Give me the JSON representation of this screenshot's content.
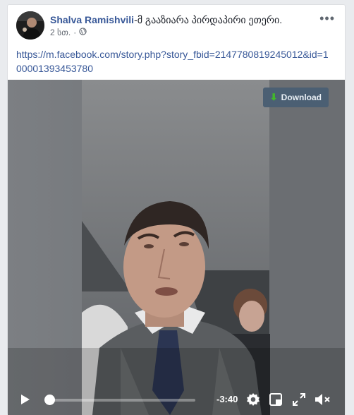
{
  "post": {
    "author": "Shalva Ramishvili",
    "title_suffix": "-მ გააზიარა პირდაპირი ეთერი.",
    "time": "2 სთ.",
    "separator": "·",
    "privacy_icon": "globe-icon",
    "more_icon": "more-options-icon",
    "more_label": "•••",
    "link": "https://m.facebook.com/story.php?story_fbid=2147780819245012&id=100001393453780"
  },
  "video": {
    "download_label": "Download",
    "download_icon": "download-arrow-icon",
    "time_remaining": "-3:40",
    "progress": 0.0,
    "colors": {
      "accent_link": "#385898",
      "download_bg": "#4b5f73",
      "download_arrow": "#42b72a"
    },
    "controls": {
      "play_icon": "play-icon",
      "settings_icon": "gear-icon",
      "pip_icon": "picture-in-picture-icon",
      "fullscreen_icon": "fullscreen-icon",
      "volume_icon": "volume-muted-icon"
    }
  }
}
